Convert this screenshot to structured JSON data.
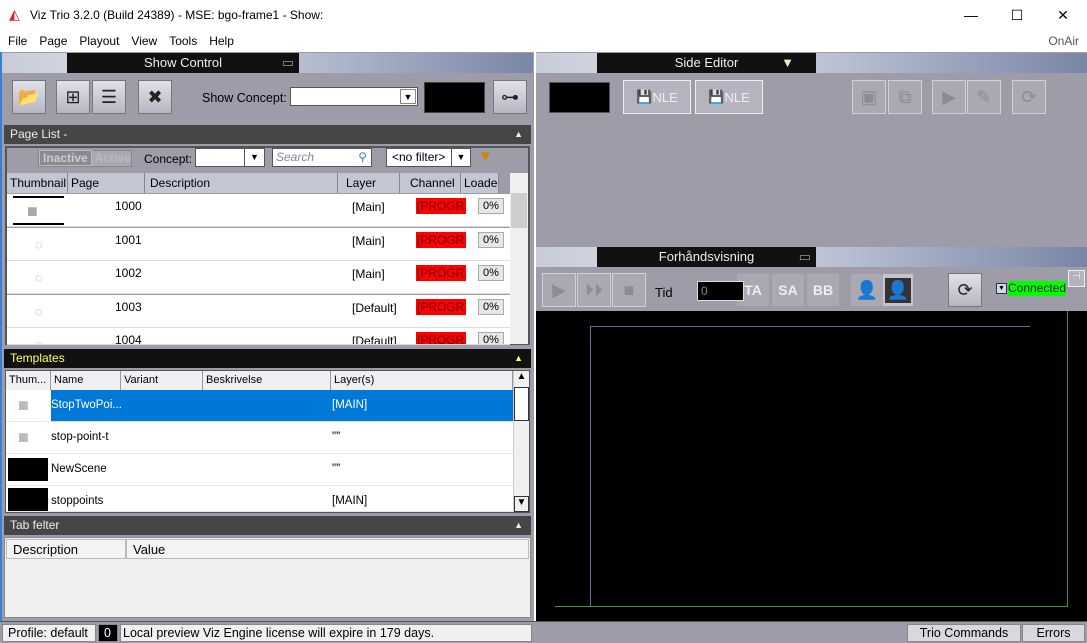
{
  "window": {
    "title": "Viz Trio 3.2.0 (Build 24389) - MSE: bgo-frame1 - Show:",
    "minimize": "—",
    "maximize": "☐",
    "close": "✕"
  },
  "menu": {
    "items": [
      "File",
      "Page",
      "Playout",
      "View",
      "Tools",
      "Help"
    ],
    "right": "OnAir"
  },
  "show_control": {
    "title": "Show Control",
    "concept_label": "Show Concept:",
    "concept_value": ""
  },
  "page_list": {
    "title": "Page List -",
    "inactive": "Inactive",
    "active": "Active",
    "concept_label": "Concept:",
    "search_placeholder": "Search",
    "filter_value": "<no filter>",
    "columns": [
      "Thumbnail",
      "Page",
      "Description",
      "Layer",
      "Channel",
      "Loaded"
    ],
    "rows": [
      {
        "page": "1000",
        "layer": "[Main]",
        "channel": "[PROGR...",
        "loaded": "0%"
      },
      {
        "page": "1001",
        "layer": "[Main]",
        "channel": "[PROGR...",
        "loaded": "0%"
      },
      {
        "page": "1002",
        "layer": "[Main]",
        "channel": "[PROGR...",
        "loaded": "0%"
      },
      {
        "page": "1003",
        "layer": "[Default]",
        "channel": "[PROGR...",
        "loaded": "0%"
      },
      {
        "page": "1004",
        "layer": "[Default]",
        "channel": "[PROGR...",
        "loaded": "0%"
      }
    ]
  },
  "templates": {
    "title": "Templates",
    "columns": [
      "Thum...",
      "Name",
      "Variant",
      "Beskrivelse",
      "Layer(s)"
    ],
    "rows": [
      {
        "name": "StopTwoPoi...",
        "layer": "[MAIN]",
        "selected": true
      },
      {
        "name": "stop-point-t",
        "layer": "\"\""
      },
      {
        "name": "NewScene",
        "layer": "\"\""
      },
      {
        "name": "stoppoints",
        "layer": "[MAIN]"
      }
    ]
  },
  "tab_felter": {
    "title": "Tab felter",
    "columns": [
      "Description",
      "Value"
    ]
  },
  "side_editor": {
    "title": "Side Editor",
    "nle1": "NLE",
    "nle2": "NLE"
  },
  "preview": {
    "title": "Forhåndsvisning",
    "tid_label": "Tid",
    "tid_value": "0",
    "ta": "TA",
    "sa": "SA",
    "bb": "BB",
    "connected": "Connected"
  },
  "status": {
    "profile": "Profile: default",
    "count": "0",
    "message": "Local preview Viz Engine license will expire in 179 days.",
    "trio_commands": "Trio Commands",
    "errors": "Errors"
  },
  "colors": {
    "accent": "#0078d7",
    "channel": "#ff0000",
    "connected": "#00ff00"
  }
}
